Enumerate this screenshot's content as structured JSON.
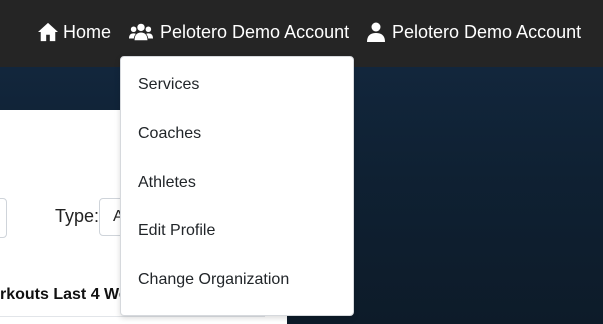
{
  "navbar": {
    "home_label": "Home",
    "org_label": "Pelotero Demo Account",
    "user_label": "Pelotero Demo Account",
    "home_icon": "home-icon",
    "org_icon": "users-icon",
    "user_icon": "user-icon"
  },
  "dropdown": {
    "items": [
      {
        "label": "Services"
      },
      {
        "label": "Coaches"
      },
      {
        "label": "Athletes"
      },
      {
        "label": "Edit Profile"
      },
      {
        "label": "Change Organization"
      }
    ]
  },
  "panel": {
    "type_label": "Type:",
    "type_value": "A",
    "workouts_title": "rkouts Last 4 We"
  },
  "colors": {
    "navbar_bg": "#252525",
    "page_bg": "#0e1d2c",
    "dropdown_bg": "#ffffff",
    "text_dark": "#212529"
  }
}
